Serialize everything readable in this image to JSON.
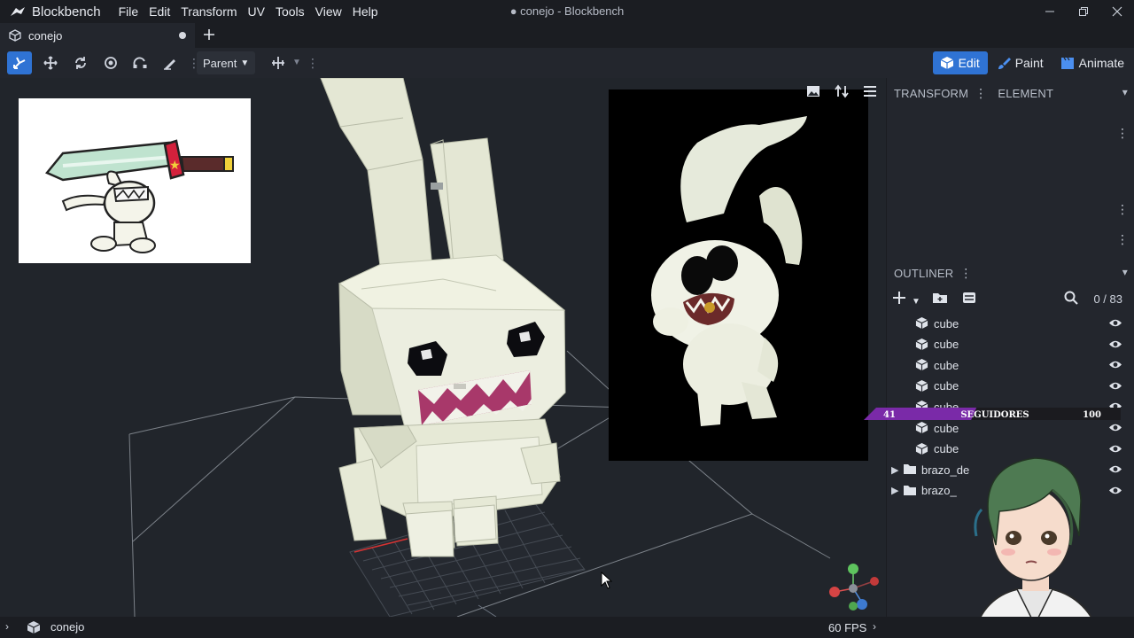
{
  "app": {
    "name": "Blockbench",
    "window_title": "● conejo - Blockbench",
    "menu": [
      "File",
      "Edit",
      "Transform",
      "UV",
      "Tools",
      "View",
      "Help"
    ]
  },
  "tabs": [
    {
      "label": "conejo",
      "unsaved": true
    }
  ],
  "toolbar": {
    "pivot_select": "Parent",
    "tools": [
      "move-tool-icon",
      "resize-tool-icon",
      "rotate-tool-icon",
      "pivot-tool-icon",
      "vertex-snap-icon",
      "seam-tool-icon"
    ]
  },
  "modes": [
    {
      "label": "Edit",
      "active": true
    },
    {
      "label": "Paint",
      "active": false
    },
    {
      "label": "Animate",
      "active": false
    }
  ],
  "panels": {
    "transform": "TRANSFORM",
    "element": "ELEMENT",
    "outliner": "OUTLINER",
    "outliner_count": "0 / 83"
  },
  "outliner": [
    {
      "type": "cube",
      "label": "cube"
    },
    {
      "type": "cube",
      "label": "cube"
    },
    {
      "type": "cube",
      "label": "cube"
    },
    {
      "type": "cube",
      "label": "cube"
    },
    {
      "type": "cube",
      "label": "cube"
    },
    {
      "type": "cube",
      "label": "cube"
    },
    {
      "type": "cube",
      "label": "cube"
    },
    {
      "type": "group",
      "label": "brazo_de"
    },
    {
      "type": "group",
      "label": "brazo_"
    }
  ],
  "overlay": {
    "followers_label": "SEGUIDORES",
    "followers_current": "41",
    "followers_goal": "100",
    "followers_progress": 0.41,
    "bar_color": "#7a2aa8"
  },
  "status": {
    "project": "conejo",
    "fps": "60 FPS"
  },
  "colors": {
    "accent": "#2f73d4",
    "model": "#e7ead8",
    "mouth": "#a8386a"
  }
}
